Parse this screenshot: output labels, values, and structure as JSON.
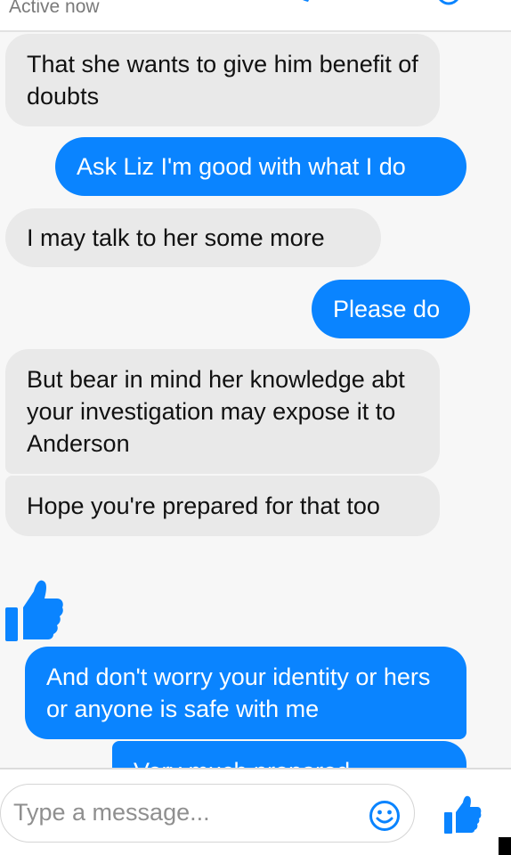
{
  "header": {
    "status": "Active now"
  },
  "messages": [
    {
      "direction": "in",
      "text": "That she wants to give him benefit of doubts"
    },
    {
      "direction": "out",
      "text": "Ask Liz I'm good with what I do"
    },
    {
      "direction": "in",
      "text": "I may talk to her some more"
    },
    {
      "direction": "out",
      "text": "Please do"
    },
    {
      "direction": "in",
      "text": "But bear in mind her knowledge abt your investigation may expose it to Anderson"
    },
    {
      "direction": "in",
      "text": "Hope you're prepared for that too"
    },
    {
      "direction": "out",
      "text": "And don't worry your identity or hers or anyone is safe with me"
    },
    {
      "direction": "out",
      "text": "Very much prepared ..."
    }
  ],
  "composer": {
    "placeholder": "Type a message..."
  },
  "icons": {
    "emoji": "smiley-icon",
    "like": "thumbs-up-icon",
    "accent": "#0a84ff"
  }
}
